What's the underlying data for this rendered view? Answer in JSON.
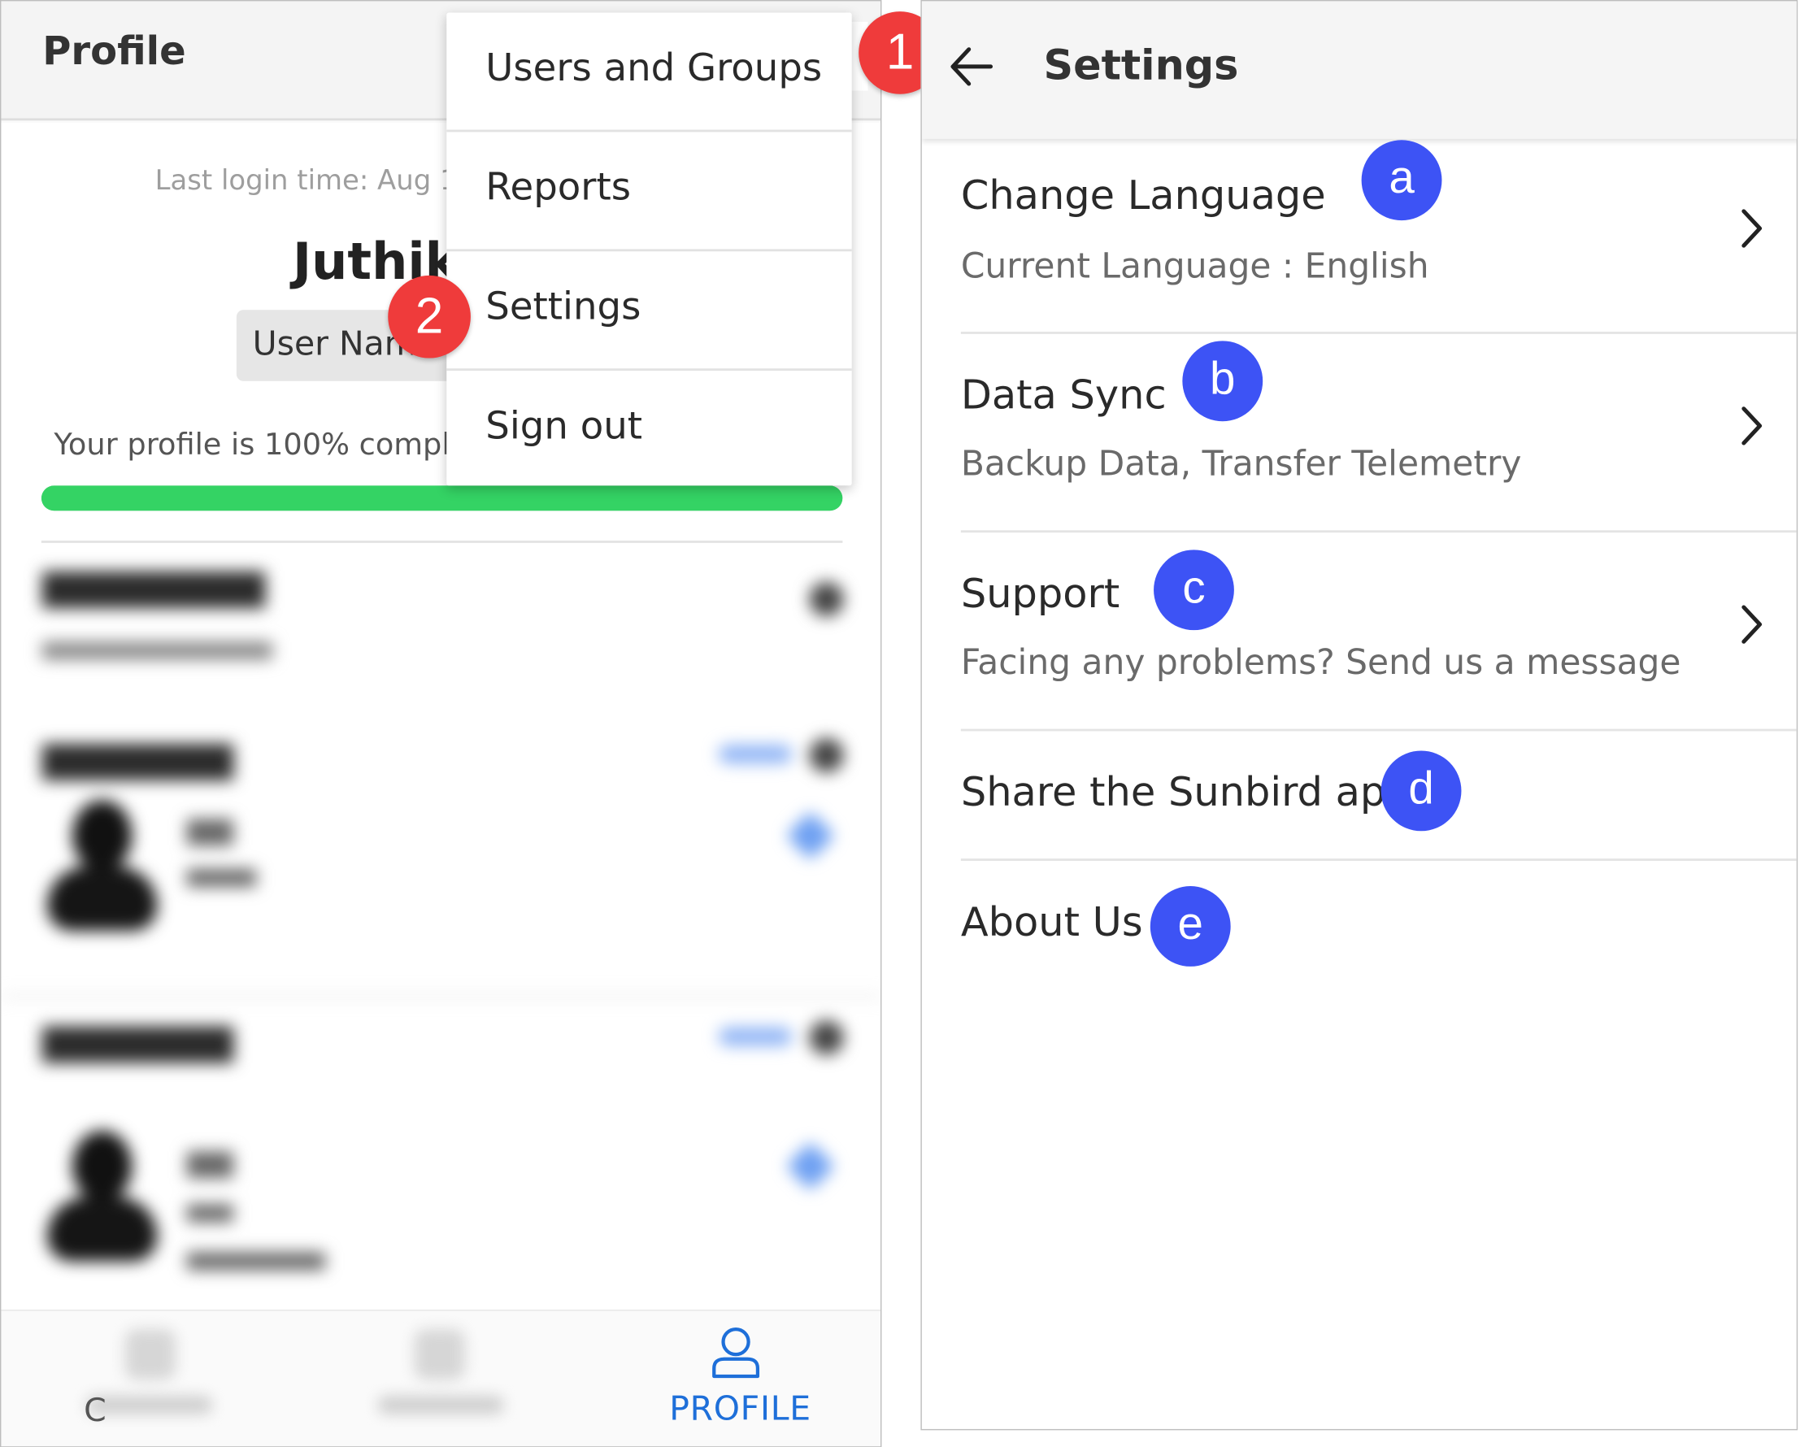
{
  "left_screen": {
    "title": "Profile",
    "last_login": "Last login time: Aug 1",
    "user_name": "Juthika",
    "username_chip": "User Name",
    "profile_completion": "Your profile is 100% compl",
    "progress_fraction": 1.0,
    "menu": {
      "items": [
        {
          "label": "Users and Groups"
        },
        {
          "label": "Reports"
        },
        {
          "label": "Settings"
        },
        {
          "label": "Sign out"
        }
      ]
    },
    "bottom_nav": {
      "partial_label": "C",
      "active_label": "PROFILE",
      "active_color": "#1e6fd9"
    },
    "progress_color": "#34d364"
  },
  "markers": {
    "step1": "1",
    "step2": "2",
    "a": "a",
    "b": "b",
    "c": "c",
    "d": "d",
    "e": "e",
    "red_color": "#ef3b3b",
    "blue_color": "#3d53f5"
  },
  "right_screen": {
    "title": "Settings",
    "items": [
      {
        "title": "Change Language",
        "subtitle": "Current Language : English",
        "chevron": true
      },
      {
        "title": "Data Sync",
        "subtitle": "Backup Data, Transfer Telemetry",
        "chevron": true
      },
      {
        "title": "Support",
        "subtitle": "Facing any problems? Send us a message",
        "chevron": true
      },
      {
        "title": "Share the Sunbird app",
        "chevron": false
      },
      {
        "title": "About Us",
        "chevron": false
      }
    ]
  }
}
